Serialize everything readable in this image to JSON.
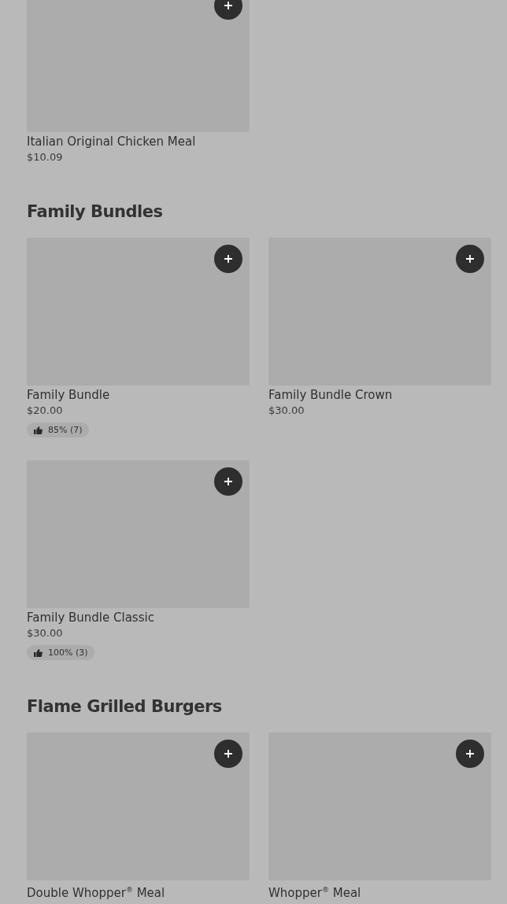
{
  "sections": [
    {
      "items": [
        {
          "name": "Italian Original Chicken Meal",
          "price": "$10.09"
        }
      ]
    },
    {
      "title": "Family Bundles",
      "items": [
        {
          "name": "Family Bundle",
          "price": "$20.00",
          "rating": "85% (7)"
        },
        {
          "name": "Family Bundle Crown",
          "price": "$30.00"
        },
        {
          "name": "Family Bundle Classic",
          "price": "$30.00",
          "rating": "100% (3)"
        }
      ]
    },
    {
      "title": "Flame Grilled Burgers",
      "items": [
        {
          "name": "Double Whopper$^{®}$ Meal"
        },
        {
          "name": "Whopper$^{®}$ Meal"
        }
      ]
    }
  ]
}
